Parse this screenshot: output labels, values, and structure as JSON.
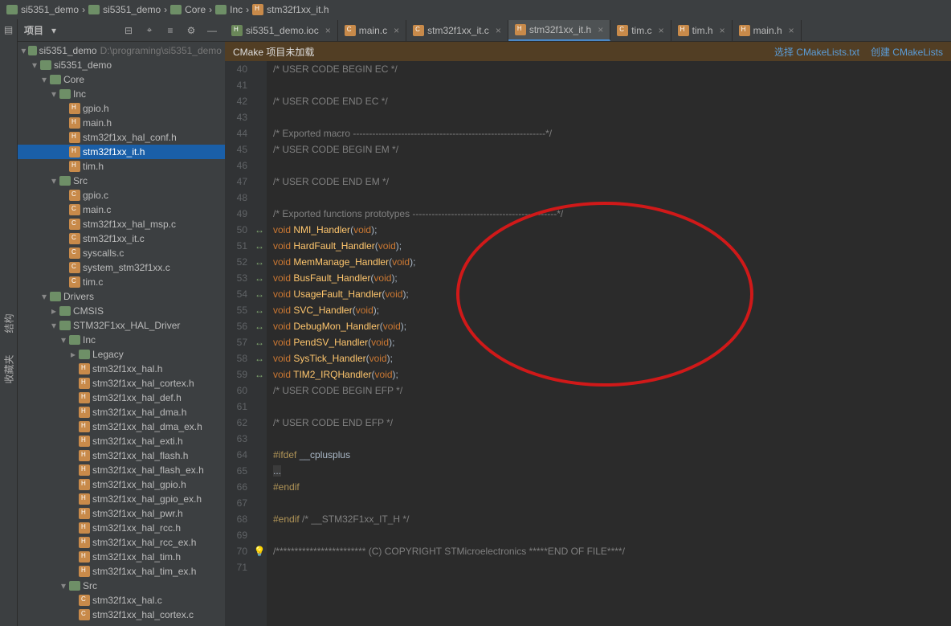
{
  "crumbs": [
    "si5351_demo",
    "si5351_demo",
    "Core",
    "Inc",
    "stm32f1xx_it.h"
  ],
  "sidebar": {
    "title": "项目",
    "path": "D:\\programing\\si5351_demo"
  },
  "tree": [
    {
      "d": 0,
      "t": "dir",
      "e": "v",
      "l": "si5351_demo",
      "dim": "D:\\programing\\si5351_demo"
    },
    {
      "d": 1,
      "t": "dir",
      "e": "v",
      "l": "si5351_demo"
    },
    {
      "d": 2,
      "t": "dir",
      "e": "v",
      "l": "Core"
    },
    {
      "d": 3,
      "t": "dir",
      "e": "v",
      "l": "Inc"
    },
    {
      "d": 4,
      "t": "h",
      "l": "gpio.h"
    },
    {
      "d": 4,
      "t": "h",
      "l": "main.h"
    },
    {
      "d": 4,
      "t": "h",
      "l": "stm32f1xx_hal_conf.h"
    },
    {
      "d": 4,
      "t": "h",
      "l": "stm32f1xx_it.h",
      "sel": true
    },
    {
      "d": 4,
      "t": "h",
      "l": "tim.h"
    },
    {
      "d": 3,
      "t": "dir",
      "e": "v",
      "l": "Src"
    },
    {
      "d": 4,
      "t": "c",
      "l": "gpio.c"
    },
    {
      "d": 4,
      "t": "c",
      "l": "main.c"
    },
    {
      "d": 4,
      "t": "c",
      "l": "stm32f1xx_hal_msp.c"
    },
    {
      "d": 4,
      "t": "c",
      "l": "stm32f1xx_it.c"
    },
    {
      "d": 4,
      "t": "c",
      "l": "syscalls.c"
    },
    {
      "d": 4,
      "t": "c",
      "l": "system_stm32f1xx.c"
    },
    {
      "d": 4,
      "t": "c",
      "l": "tim.c"
    },
    {
      "d": 2,
      "t": "dir",
      "e": "v",
      "l": "Drivers"
    },
    {
      "d": 3,
      "t": "dir",
      "e": ">",
      "l": "CMSIS"
    },
    {
      "d": 3,
      "t": "dir",
      "e": "v",
      "l": "STM32F1xx_HAL_Driver"
    },
    {
      "d": 4,
      "t": "dir",
      "e": "v",
      "l": "Inc"
    },
    {
      "d": 5,
      "t": "dir",
      "e": ">",
      "l": "Legacy"
    },
    {
      "d": 5,
      "t": "h",
      "l": "stm32f1xx_hal.h"
    },
    {
      "d": 5,
      "t": "h",
      "l": "stm32f1xx_hal_cortex.h"
    },
    {
      "d": 5,
      "t": "h",
      "l": "stm32f1xx_hal_def.h"
    },
    {
      "d": 5,
      "t": "h",
      "l": "stm32f1xx_hal_dma.h"
    },
    {
      "d": 5,
      "t": "h",
      "l": "stm32f1xx_hal_dma_ex.h"
    },
    {
      "d": 5,
      "t": "h",
      "l": "stm32f1xx_hal_exti.h"
    },
    {
      "d": 5,
      "t": "h",
      "l": "stm32f1xx_hal_flash.h"
    },
    {
      "d": 5,
      "t": "h",
      "l": "stm32f1xx_hal_flash_ex.h"
    },
    {
      "d": 5,
      "t": "h",
      "l": "stm32f1xx_hal_gpio.h"
    },
    {
      "d": 5,
      "t": "h",
      "l": "stm32f1xx_hal_gpio_ex.h"
    },
    {
      "d": 5,
      "t": "h",
      "l": "stm32f1xx_hal_pwr.h"
    },
    {
      "d": 5,
      "t": "h",
      "l": "stm32f1xx_hal_rcc.h"
    },
    {
      "d": 5,
      "t": "h",
      "l": "stm32f1xx_hal_rcc_ex.h"
    },
    {
      "d": 5,
      "t": "h",
      "l": "stm32f1xx_hal_tim.h"
    },
    {
      "d": 5,
      "t": "h",
      "l": "stm32f1xx_hal_tim_ex.h"
    },
    {
      "d": 4,
      "t": "dir",
      "e": "v",
      "l": "Src"
    },
    {
      "d": 5,
      "t": "c",
      "l": "stm32f1xx_hal.c"
    },
    {
      "d": 5,
      "t": "c",
      "l": "stm32f1xx_hal_cortex.c"
    }
  ],
  "tabs": [
    {
      "l": "si5351_demo.ioc",
      "t": "ioc"
    },
    {
      "l": "main.c",
      "t": "c"
    },
    {
      "l": "stm32f1xx_it.c",
      "t": "c"
    },
    {
      "l": "stm32f1xx_it.h",
      "t": "h",
      "active": true
    },
    {
      "l": "tim.c",
      "t": "c"
    },
    {
      "l": "tim.h",
      "t": "h"
    },
    {
      "l": "main.h",
      "t": "h"
    }
  ],
  "banner": {
    "msg": "CMake 项目未加载",
    "link1": "选择 CMakeLists.txt",
    "link2": "创建 CMakeLists"
  },
  "code": {
    "start": 40,
    "lines": [
      {
        "g": "",
        "h": "<span class='cm'>/* USER CODE BEGIN EC */</span>"
      },
      {
        "g": "",
        "h": ""
      },
      {
        "g": "",
        "h": "<span class='cm'>/* USER CODE END EC */</span>"
      },
      {
        "g": "",
        "h": ""
      },
      {
        "g": "",
        "h": "<span class='cm'>/* Exported macro ------------------------------------------------------------*/</span>"
      },
      {
        "g": "",
        "h": "<span class='cm'>/* USER CODE BEGIN EM */</span>"
      },
      {
        "g": "",
        "h": ""
      },
      {
        "g": "",
        "h": "<span class='cm'>/* USER CODE END EM */</span>"
      },
      {
        "g": "",
        "h": ""
      },
      {
        "g": "",
        "h": "<span class='cm'>/* Exported functions prototypes ---------------------------------------------*/</span>"
      },
      {
        "g": "↔",
        "h": "<span class='kw'>void</span> <span class='fn'>NMI_Handler</span>(<span class='kw'>void</span>);"
      },
      {
        "g": "↔",
        "h": "<span class='kw'>void</span> <span class='fn'>HardFault_Handler</span>(<span class='kw'>void</span>);"
      },
      {
        "g": "↔",
        "h": "<span class='kw'>void</span> <span class='fn'>MemManage_Handler</span>(<span class='kw'>void</span>);"
      },
      {
        "g": "↔",
        "h": "<span class='kw'>void</span> <span class='fn'>BusFault_Handler</span>(<span class='kw'>void</span>);"
      },
      {
        "g": "↔",
        "h": "<span class='kw'>void</span> <span class='fn'>UsageFault_Handler</span>(<span class='kw'>void</span>);"
      },
      {
        "g": "↔",
        "h": "<span class='kw'>void</span> <span class='fn'>SVC_Handler</span>(<span class='kw'>void</span>);"
      },
      {
        "g": "↔",
        "h": "<span class='kw'>void</span> <span class='fn'>DebugMon_Handler</span>(<span class='kw'>void</span>);"
      },
      {
        "g": "↔",
        "h": "<span class='kw'>void</span> <span class='fn'>PendSV_Handler</span>(<span class='kw'>void</span>);"
      },
      {
        "g": "↔",
        "h": "<span class='kw'>void</span> <span class='fn'>SysTick_Handler</span>(<span class='kw'>void</span>);"
      },
      {
        "g": "↔",
        "h": "<span class='kw'>void</span> <span class='fn'>TIM2_IRQHandler</span>(<span class='kw'>void</span>);"
      },
      {
        "g": "",
        "h": "<span class='cm'>/* USER CODE BEGIN EFP */</span>"
      },
      {
        "g": "",
        "h": ""
      },
      {
        "g": "",
        "h": "<span class='cm'>/* USER CODE END EFP */</span>"
      },
      {
        "g": "",
        "h": ""
      },
      {
        "g": "",
        "h": "<span class='pp'>#ifdef</span> __cplusplus"
      },
      {
        "g": "",
        "h": "<span style='background:#3b3b3b'>...</span>"
      },
      {
        "g": "",
        "h": "<span class='pp'>#endif</span>"
      },
      {
        "g": "",
        "h": ""
      },
      {
        "g": "",
        "h": "<span class='pp'>#endif</span> <span class='cm'>/* __STM32F1xx_IT_H */</span>"
      },
      {
        "g": "",
        "h": ""
      },
      {
        "g": "💡",
        "h": "<span class='cm'>/************************ (C) COPYRIGHT STMicroelectronics *****END OF FILE****/</span>"
      },
      {
        "g": "",
        "h": ""
      }
    ]
  },
  "vbar": {
    "a": "结构",
    "b": "收藏夹"
  }
}
